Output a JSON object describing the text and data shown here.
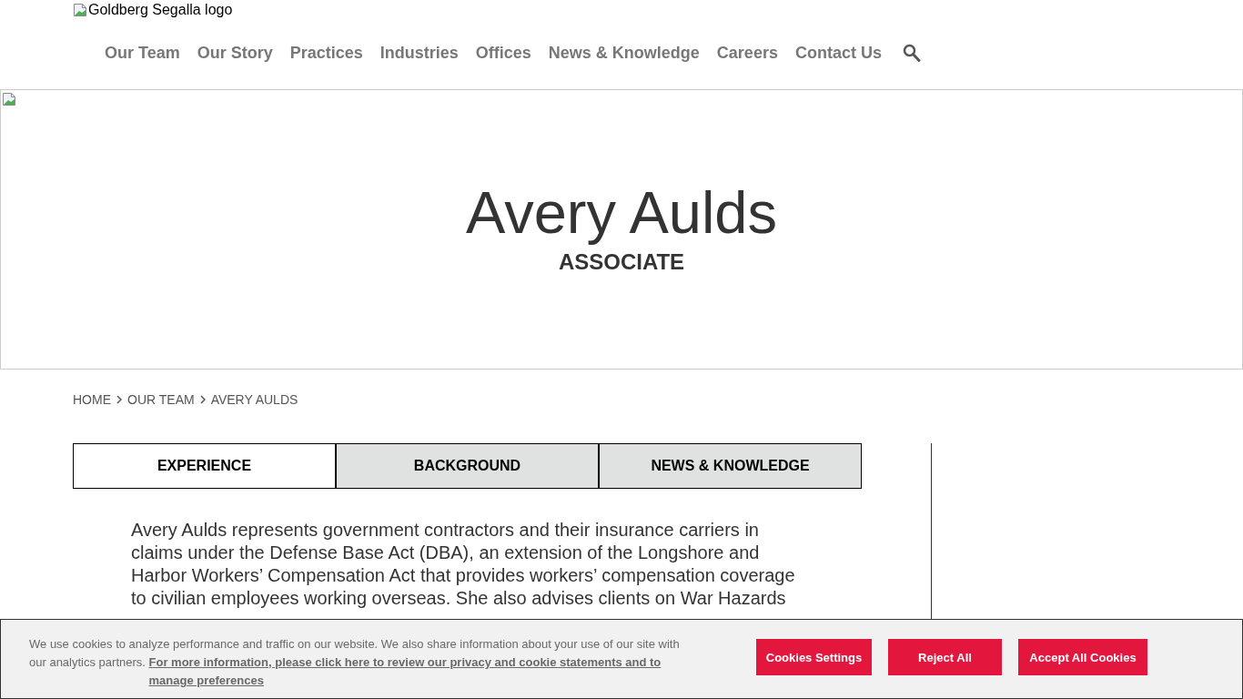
{
  "logo": {
    "alt_text": "Goldberg Segalla logo"
  },
  "nav": {
    "items": [
      "Our Team",
      "Our Story",
      "Practices",
      "Industries",
      "Offices",
      "News & Knowledge",
      "Careers",
      "Contact Us"
    ]
  },
  "hero": {
    "name": "Avery Aulds",
    "title": "ASSOCIATE"
  },
  "breadcrumb": [
    "HOME",
    "OUR TEAM",
    "AVERY AULDS"
  ],
  "tabs": [
    {
      "label": "EXPERIENCE",
      "selected": true
    },
    {
      "label": "BACKGROUND",
      "selected": false
    },
    {
      "label": "NEWS & KNOWLEDGE",
      "selected": false
    }
  ],
  "content": {
    "paragraph": "Avery Aulds represents government contractors and their insurance carriers in claims under the Defense Base Act (DBA), an extension of the Longshore and Harbor Workers’ Compensation Act that provides workers’ compensation coverage to civilian employees working overseas. She also advises clients on War Hazards"
  },
  "cookie_banner": {
    "text": "We use cookies to analyze performance and traffic on our website. We also share information about your use of our site with our analytics partners.",
    "link": "For more information, please click here to review our privacy and cookie statements and to manage preferences",
    "buttons": [
      "Cookies Settings",
      "Reject All",
      "Accept All Cookies"
    ]
  }
}
